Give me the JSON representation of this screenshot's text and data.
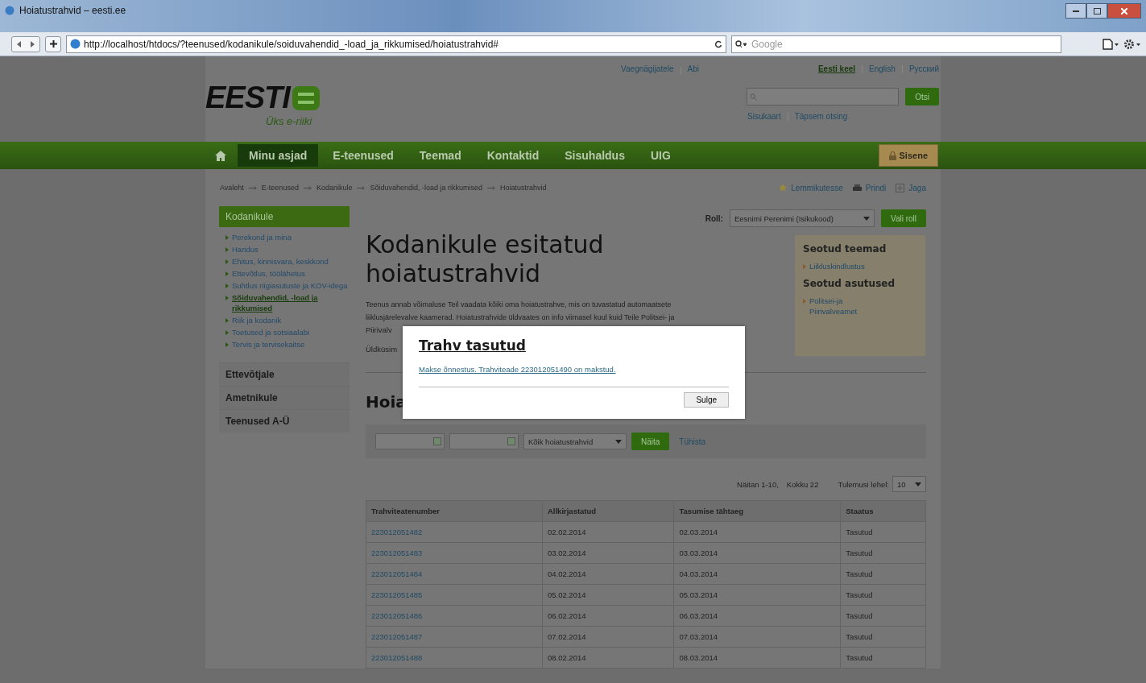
{
  "browser": {
    "title": "Hoiatustrahvid – eesti.ee",
    "url": "http://localhost/htdocs/?teenused/kodanikule/soiduvahendid_-load_ja_rikkumised/hoiatustrahvid#",
    "search_placeholder": "Google"
  },
  "header": {
    "logo_text": "EESTI",
    "tagline": "Üks e-riiki",
    "top_links": [
      "Vaegnägijatele",
      "Abi"
    ],
    "languages": [
      {
        "label": "Eesti keel",
        "selected": true
      },
      {
        "label": "English",
        "selected": false
      },
      {
        "label": "Русский",
        "selected": false
      }
    ],
    "search_button": "Otsi",
    "search_links": [
      "Sisukaart",
      "Täpsem otsing"
    ]
  },
  "nav": {
    "items": [
      {
        "label": "Minu asjad",
        "selected": true
      },
      {
        "label": "E-teenused",
        "selected": false
      },
      {
        "label": "Teemad",
        "selected": false
      },
      {
        "label": "Kontaktid",
        "selected": false
      },
      {
        "label": "Sisuhaldus",
        "selected": false
      },
      {
        "label": "UIG",
        "selected": false
      }
    ],
    "login": "Sisene"
  },
  "breadcrumb": [
    "Avaleht",
    "E-teenused",
    "Kodanikule",
    "Sõiduvahendid, -load ja rikkumised",
    "Hoiatustrahvid"
  ],
  "page_actions": [
    "Lemmikutesse",
    "Prindi",
    "Jaga"
  ],
  "sidebar": {
    "title": "Kodanikule",
    "items": [
      {
        "label": "Perekond ja mina",
        "selected": false
      },
      {
        "label": "Haridus",
        "selected": false
      },
      {
        "label": "Ehitus, kinnisvara, keskkond",
        "selected": false
      },
      {
        "label": "Ettevõtlus, töölähetus",
        "selected": false
      },
      {
        "label": "Suhtlus riigiasutuste ja KOV-idega",
        "selected": false
      },
      {
        "label": "Sõiduvahendid, -load ja rikkumised",
        "selected": true
      },
      {
        "label": "Riik ja kodanik",
        "selected": false
      },
      {
        "label": "Toetused ja sotsiaalabi",
        "selected": false
      },
      {
        "label": "Tervis ja tervisekaitse",
        "selected": false
      }
    ],
    "sections": [
      "Ettevõtjale",
      "Ametnikule",
      "Teenused A-Ü"
    ]
  },
  "role": {
    "label": "Roll:",
    "value": "Eesnimi Perenimi (Isikukood)",
    "button": "Vali roll"
  },
  "page_title": "Kodanikule esitatud hoiatustrahvid",
  "intro": "Teenus annab võimaluse Teil vaadata kõiki oma hoiatustrahve, mis on tuvastatud automaatsete liiklusjärelevalve kaamerad. Hoiatustrahvide üldvaates on info viimasel kuul kuid Teile Politsei- ja",
  "intro_rest": "Piirivalv",
  "general_text": "Üldküsim",
  "section_heading": "Hoia",
  "related": [
    {
      "heading": "Seotud teemad",
      "links": [
        "Liikluskindlustus"
      ]
    },
    {
      "heading": "Seotud asutused",
      "links": [
        "Politsei-ja Piirivalveamet"
      ]
    }
  ],
  "filter": {
    "type_select": "Kõik hoiatustrahvid",
    "button": "Näita",
    "reset": "Tühista"
  },
  "pager": {
    "summary": "Näitan 1-10,",
    "total": "Kokku 22",
    "per_page_label": "Tulemusi lehel:",
    "per_page": "10"
  },
  "table": {
    "columns": [
      "Trahviteatenumber",
      "Allkirjastatud",
      "Tasumise tähtaeg",
      "Staatus"
    ],
    "rows": [
      [
        "223012051482",
        "02.02.2014",
        "02.03.2014",
        "Tasutud"
      ],
      [
        "223012051483",
        "03.02.2014",
        "03.03.2014",
        "Tasutud"
      ],
      [
        "223012051484",
        "04.02.2014",
        "04.03.2014",
        "Tasutud"
      ],
      [
        "223012051485",
        "05.02.2014",
        "05.03.2014",
        "Tasutud"
      ],
      [
        "223012051486",
        "06.02.2014",
        "06.03.2014",
        "Tasutud"
      ],
      [
        "223012051487",
        "07.02.2014",
        "07.03.2014",
        "Tasutud"
      ],
      [
        "223012051488",
        "08.02.2014",
        "08.03.2014",
        "Tasutud"
      ]
    ]
  },
  "dialog": {
    "title": "Trahv tasutud",
    "message": "Makse õnnestus. Trahviteade 223012051490 on makstud.",
    "button": "Sulge"
  }
}
